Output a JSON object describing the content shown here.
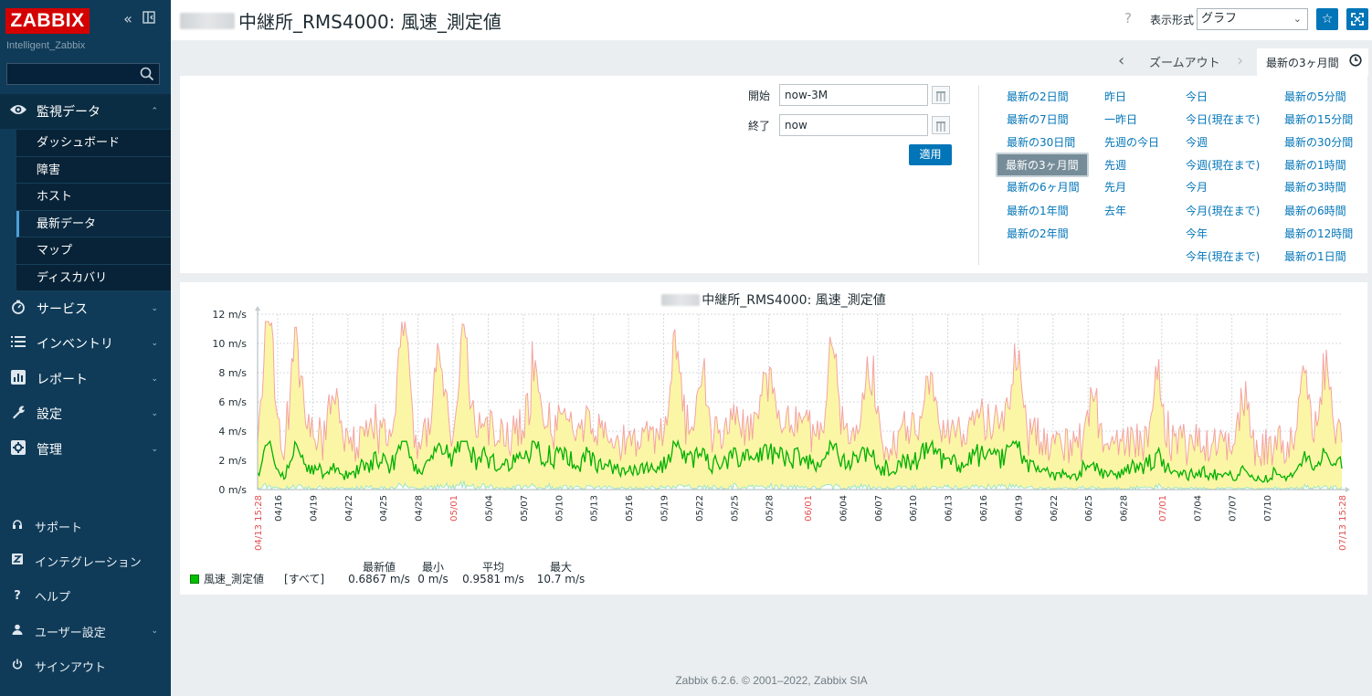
{
  "app": {
    "logo": "ZABBIX",
    "server_name": "Intelligent_Zabbix",
    "footer": "Zabbix 6.2.6. © 2001–2022, Zabbix SIA"
  },
  "sidebar": {
    "main_menu": [
      {
        "label": "監視データ",
        "icon": "eye-icon",
        "expanded": true
      },
      {
        "label": "サービス",
        "icon": "stopwatch-icon"
      },
      {
        "label": "インベントリ",
        "icon": "list-icon"
      },
      {
        "label": "レポート",
        "icon": "bar-report-icon"
      },
      {
        "label": "設定",
        "icon": "wrench-icon"
      },
      {
        "label": "管理",
        "icon": "admin-gear-icon"
      }
    ],
    "submenu": [
      "ダッシュボード",
      "障害",
      "ホスト",
      "最新データ",
      "マップ",
      "ディスカバリ"
    ],
    "active_submenu": "最新データ",
    "bottom": [
      {
        "label": "サポート",
        "icon": "support-icon"
      },
      {
        "label": "インテグレーション",
        "icon": "integration-icon"
      },
      {
        "label": "ヘルプ",
        "icon": "help-icon"
      },
      {
        "label": "ユーザー設定",
        "icon": "user-icon"
      },
      {
        "label": "サインアウト",
        "icon": "power-icon"
      }
    ]
  },
  "header": {
    "title": "中継所_RMS4000: 風速_測定値",
    "view_label": "表示形式",
    "view_value": "グラフ",
    "help": "?"
  },
  "time": {
    "zoom_out": "ズームアウト",
    "active_tab": "最新の3ヶ月間",
    "from_label": "開始",
    "from_value": "now-3M",
    "to_label": "終了",
    "to_value": "now",
    "apply": "適用",
    "quick_ranges": [
      [
        "最新の2日間",
        "最新の7日間",
        "最新の30日間",
        "最新の3ヶ月間",
        "最新の6ヶ月間",
        "最新の1年間",
        "最新の2年間"
      ],
      [
        "昨日",
        "一昨日",
        "先週の今日",
        "先週",
        "先月",
        "去年"
      ],
      [
        "今日",
        "今日(現在まで)",
        "今週",
        "今週(現在まで)",
        "今月",
        "今月(現在まで)",
        "今年",
        "今年(現在まで)"
      ],
      [
        "最新の5分間",
        "最新の15分間",
        "最新の30分間",
        "最新の1時間",
        "最新の3時間",
        "最新の6時間",
        "最新の12時間",
        "最新の1日間"
      ]
    ],
    "selected_range": "最新の3ヶ月間"
  },
  "graph": {
    "title": "中継所_RMS4000: 風速_測定値",
    "legend": {
      "name": "風速_測定値",
      "scope": "[すべて]",
      "headers": [
        "最新値",
        "最小",
        "平均",
        "最大"
      ],
      "values": [
        "0.6867 m/s",
        "0 m/s",
        "0.9581 m/s",
        "10.7 m/s"
      ]
    }
  },
  "chart_data": {
    "type": "area",
    "title": "中継所_RMS4000: 風速_測定値",
    "ylim": [
      0,
      12
    ],
    "yticks": [
      "0 m/s",
      "2 m/s",
      "4 m/s",
      "6 m/s",
      "8 m/s",
      "10 m/s",
      "12 m/s"
    ],
    "xticks": [
      "04/13 15:28",
      "04/16",
      "04/19",
      "04/22",
      "04/25",
      "04/28",
      "05/01",
      "05/04",
      "05/07",
      "05/10",
      "05/13",
      "05/16",
      "05/19",
      "05/22",
      "05/25",
      "05/28",
      "06/01",
      "06/04",
      "06/07",
      "06/10",
      "06/13",
      "06/16",
      "06/19",
      "06/22",
      "06/25",
      "06/28",
      "07/01",
      "07/04",
      "07/07",
      "07/10",
      "07/13 15:28"
    ],
    "xticks_highlight": [
      "04/13 15:28",
      "05/01",
      "06/01",
      "07/01",
      "07/13 15:28"
    ],
    "grid": true,
    "series": [
      {
        "name": "風速_測定値 最大",
        "color": "#f4a3a3"
      },
      {
        "name": "風速_測定値 平均",
        "color": "#00b000",
        "fill": "#fbf6a6"
      },
      {
        "name": "風速_測定値 最小",
        "color": "#9fe6c8"
      }
    ],
    "peaks": [
      {
        "x": "04/14",
        "y": 10.7
      },
      {
        "x": "04/15",
        "y": 9.4
      },
      {
        "x": "04/25",
        "y": 8.9
      },
      {
        "x": "04/28",
        "y": 7.5
      },
      {
        "x": "04/29",
        "y": 7.9
      },
      {
        "x": "05/19",
        "y": 8.2
      },
      {
        "x": "05/20",
        "y": 6.6
      },
      {
        "x": "06/01",
        "y": 6.8
      },
      {
        "x": "06/02",
        "y": 6.3
      },
      {
        "x": "06/22",
        "y": 6.7
      },
      {
        "x": "07/11",
        "y": 6.3
      },
      {
        "x": "07/12",
        "y": 6.2
      }
    ]
  }
}
